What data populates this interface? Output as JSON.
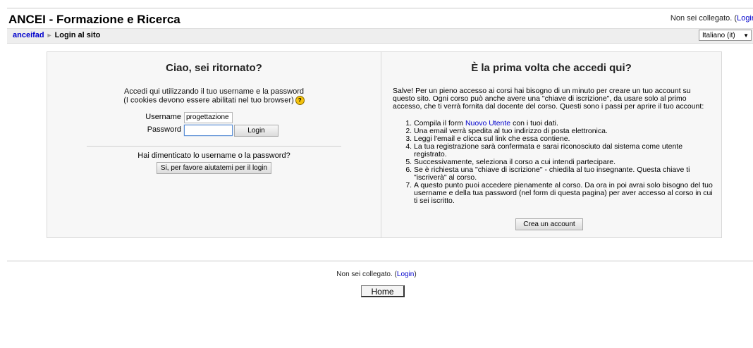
{
  "header": {
    "site_title": "ANCEI - Formazione e Ricerca",
    "status_prefix": "Non sei collegato. (",
    "status_link": "Login"
  },
  "navbar": {
    "home": "anceifad",
    "current": "Login al sito",
    "language": "Italiano (it)"
  },
  "login": {
    "title": "Ciao, sei ritornato?",
    "desc_line1": "Accedi qui utilizzando il tuo username e la password",
    "desc_line2": "(I cookies devono essere abilitati nel tuo browser)",
    "username_label": "Username",
    "username_value": "progettazione",
    "password_label": "Password",
    "password_value": "",
    "login_button": "Login",
    "forgot_text": "Hai dimenticato lo username o la password?",
    "forgot_button": "Si, per favore aiutatemi per il login"
  },
  "signup": {
    "title": "È la prima volta che accedi qui?",
    "intro": "Salve! Per un pieno accesso ai corsi hai bisogno di un minuto per creare un tuo account su questo sito. Ogni corso può anche avere una \"chiave di iscrizione\", da usare solo al primo accesso, che ti verrà fornita dal docente del corso. Questi sono i passi per aprire il tuo account:",
    "step1_pre": "Compila il form ",
    "step1_link": "Nuovo Utente",
    "step1_post": " con i tuoi dati.",
    "steps": [
      "Una email verrà spedita al tuo indirizzo di posta elettronica.",
      "Leggi l'email e clicca sul link che essa contiene.",
      "La tua registrazione sarà confermata e sarai riconosciuto dal sistema come utente registrato.",
      "Successivamente, seleziona il corso a cui intendi partecipare.",
      "Se è richiesta una \"chiave di iscrizione\" - chiedila al tuo insegnante. Questa chiave ti \"iscriverà\" al corso.",
      "A questo punto puoi accedere pienamente al corso. Da ora in poi avrai solo bisogno del tuo username e della tua password (nel form di questa pagina) per aver accesso al corso in cui ti sei iscritto."
    ],
    "create_button": "Crea un account"
  },
  "footer": {
    "status_prefix": "Non sei collegato. (",
    "status_link": "Login",
    "status_suffix": ")",
    "home_button": "Home"
  }
}
